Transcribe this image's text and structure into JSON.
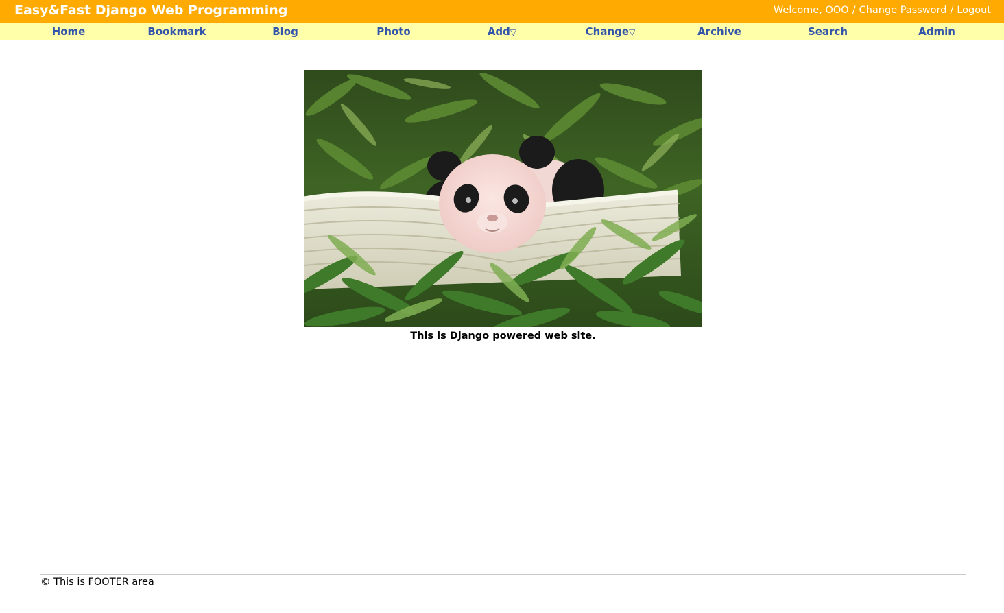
{
  "header": {
    "site_title": "Easy&Fast Django Web Programming",
    "welcome_text": "Welcome, OOO",
    "change_password_label": "Change Password",
    "logout_label": "Logout",
    "separator": "/",
    "background_color": "#ffaa00",
    "text_color": "#ffffff"
  },
  "nav": {
    "background_color": "#ffffaa",
    "link_color": "#3355aa",
    "dropdown_arrow": "▽",
    "items": [
      {
        "label": "Home"
      },
      {
        "label": "Bookmark"
      },
      {
        "label": "Blog"
      },
      {
        "label": "Photo"
      },
      {
        "label": "Add",
        "dropdown": true
      },
      {
        "label": "Change",
        "dropdown": true
      },
      {
        "label": "Archive"
      },
      {
        "label": "Search"
      },
      {
        "label": "Admin"
      }
    ]
  },
  "main": {
    "image_subject": "baby-panda-in-wicker-basket-with-bamboo",
    "caption": "This is Django powered web site."
  },
  "footer": {
    "text": "© This is FOOTER area"
  }
}
